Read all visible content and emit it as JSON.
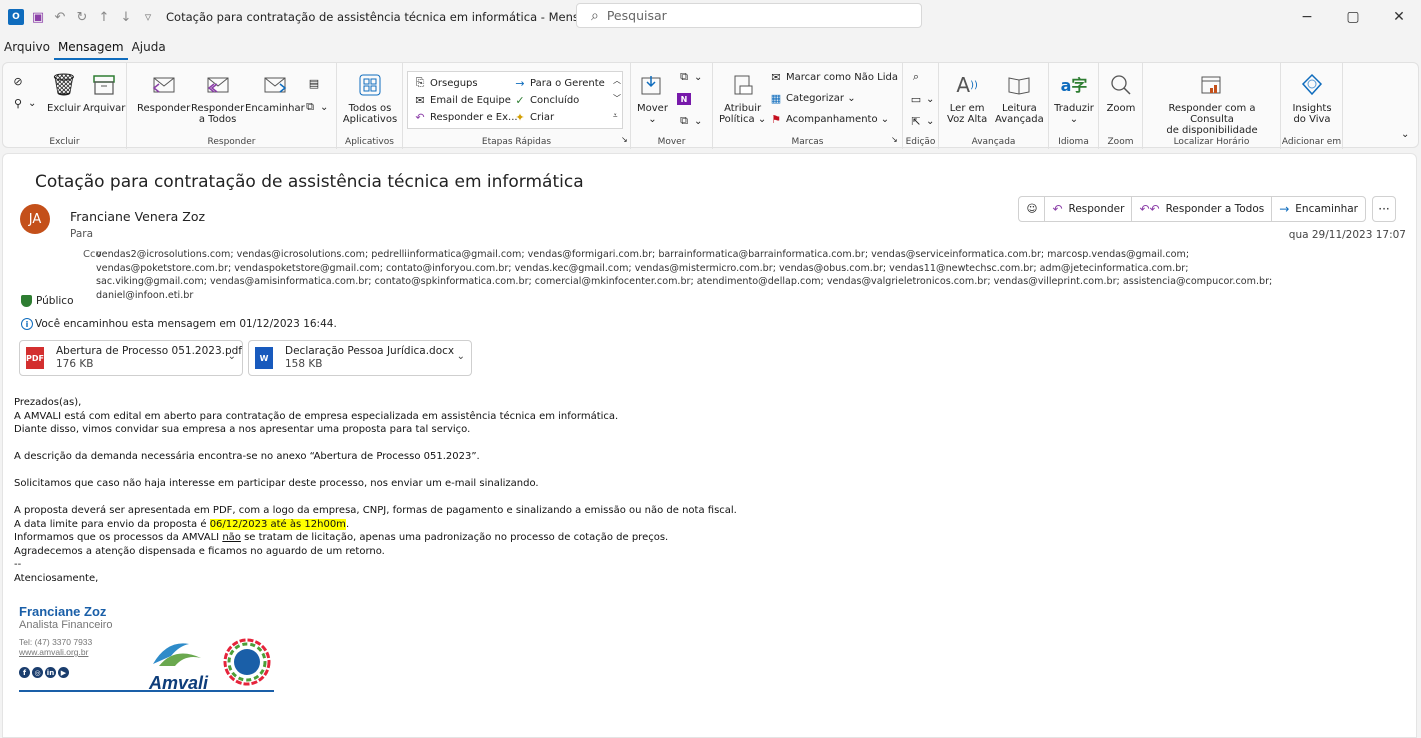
{
  "window": {
    "title": "Cotação para contratação de assistência técnica em informática  -  Mensagem (HTML)",
    "search_placeholder": "Pesquisar"
  },
  "menu": [
    "Arquivo",
    "Mensagem",
    "Ajuda"
  ],
  "ribbon": {
    "excluir_group": {
      "label": "Excluir",
      "excluir": "Excluir",
      "arquivar": "Arquivar"
    },
    "responder_group": {
      "label": "Responder",
      "responder": "Responder",
      "responder_todos_1": "Responder",
      "responder_todos_2": "a Todos",
      "encaminhar": "Encaminhar"
    },
    "aplicativos_group": {
      "label": "Aplicativos",
      "todos_1": "Todos os",
      "todos_2": "Aplicativos"
    },
    "etapas_group": {
      "label": "Etapas Rápidas",
      "items": [
        "Orsegups",
        "Email de Equipe",
        "Responder e Ex...",
        "Para o Gerente",
        "Concluído",
        "Criar"
      ]
    },
    "mover_group": {
      "label": "Mover",
      "mover": "Mover"
    },
    "marcas_group": {
      "label": "Marcas",
      "atribuir_1": "Atribuir",
      "atribuir_2": "Política",
      "marcar": "Marcar como Não Lida",
      "categorizar": "Categorizar",
      "acompanhamento": "Acompanhamento"
    },
    "edicao_group": {
      "label": "Edição"
    },
    "avancada_group": {
      "label": "Avançada",
      "ler_1": "Ler em",
      "ler_2": "Voz Alta",
      "leitura_1": "Leitura",
      "leitura_2": "Avançada"
    },
    "idioma_group": {
      "label": "Idioma",
      "traduzir": "Traduzir"
    },
    "zoom_group": {
      "label": "Zoom",
      "zoom": "Zoom"
    },
    "horario_group": {
      "label": "Localizar Horário",
      "resp_1": "Responder com a Consulta",
      "resp_2": "de disponibilidade"
    },
    "adicionar_group": {
      "label": "Adicionar em",
      "insights_1": "Insights",
      "insights_2": "do Viva"
    }
  },
  "message": {
    "subject": "Cotação para contratação de assistência técnica em informática",
    "avatar_initials": "JA",
    "sender": "Franciane Venera Zoz",
    "to_label": "Para",
    "cco_label": "Cco",
    "cco": "vendas2@icrosolutions.com; vendas@icrosolutions.com; pedrelliinformatica@gmail.com; vendas@formigari.com.br; barrainformatica@barrainformatica.com.br; vendas@serviceinformatica.com.br; marcosp.vendas@gmail.com; vendas@poketstore.com.br; vendaspoketstore@gmail.com; contato@inforyou.com.br; vendas.kec@gmail.com; vendas@mistermicro.com.br; vendas@obus.com.br; vendas11@newtechsc.com.br; adm@jetecinformatica.com.br; sac.viking@gmail.com; vendas@amisinformatica.com.br; contato@spkinformatica.com.br; comercial@mkinfocenter.com.br; atendimento@dellap.com; vendas@valgrieletronicos.com.br; vendas@villeprint.com.br; assistencia@compucor.com.br; daniel@infoon.eti.br",
    "date": "qua 29/11/2023 17:07",
    "actions": {
      "responder": "Responder",
      "responder_todos": "Responder a Todos",
      "encaminhar": "Encaminhar"
    },
    "sensitivity": "Público",
    "forward_info": "Você encaminhou esta mensagem em 01/12/2023 16:44.",
    "attachments": [
      {
        "name": "Abertura de Processo 051.2023.pdf",
        "size": "176 KB"
      },
      {
        "name": "Declaração Pessoa Jurídica.docx",
        "size": "158 KB"
      }
    ],
    "body": {
      "l1": "Prezados(as),",
      "l2": "A AMVALI está com edital em aberto para contratação de empresa especializada em assistência técnica em informática.",
      "l3": "Diante disso, vimos convidar sua empresa a nos apresentar uma proposta para tal serviço.",
      "l4": "A descrição da demanda necessária encontra-se no anexo “Abertura de Processo 051.2023”.",
      "l5": "Solicitamos que caso não haja interesse em participar deste processo, nos enviar um e-mail sinalizando.",
      "l6": "A proposta deverá ser apresentada em PDF, com a logo da empresa, CNPJ, formas de pagamento e sinalizando a emissão ou não de nota fiscal.",
      "l7a": "A data limite para envio da proposta é ",
      "l7b": "06/12/2023 até às 12h00m",
      "l7c": ".",
      "l8a": "Informamos que os processos da AMVALI ",
      "l8b": "não",
      "l8c": " se tratam de licitação, apenas uma padronização no processo de cotação de preços.",
      "l9": "Agradecemos a atenção dispensada e ficamos no aguardo de um retorno.",
      "l10": "--",
      "l11": "Atenciosamente,"
    },
    "signature": {
      "name": "Franciane Zoz",
      "role": "Analista Financeiro",
      "tel": "Tel: (47) 3370 7933",
      "web": "www.amvali.org.br",
      "logo": "Amvali"
    }
  }
}
